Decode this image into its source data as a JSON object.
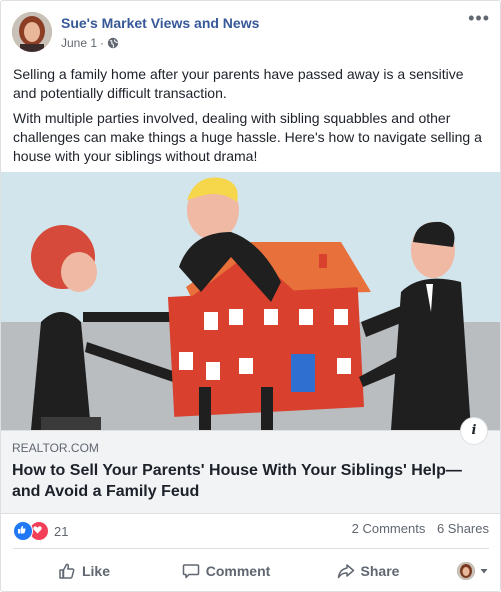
{
  "post": {
    "page_name": "Sue's Market Views and News",
    "date": "June 1",
    "more_icon": "more-horizontal-icon",
    "privacy_icon": "globe-icon",
    "paragraphs": [
      "Selling a family home after your parents have passed away is a sensitive and potentially difficult transaction.",
      "With multiple parties involved, dealing with sibling squabbles and other challenges can make things a huge hassle. Here's how to navigate selling a house with your siblings without drama!"
    ]
  },
  "link": {
    "domain": "REALTOR.COM",
    "title": "How to Sell Your Parents' House With Your Siblings' Help—and Avoid a Family Feud",
    "info_label": "i"
  },
  "stats": {
    "reaction_count": "21",
    "comments": "2 Comments",
    "shares": "6 Shares"
  },
  "actions": {
    "like": "Like",
    "comment": "Comment",
    "share": "Share"
  },
  "colors": {
    "page_name": "#365899",
    "like_blue": "#2078f4",
    "love_red": "#f33e58",
    "house_red": "#d9402e",
    "roof_orange": "#e8703a"
  }
}
